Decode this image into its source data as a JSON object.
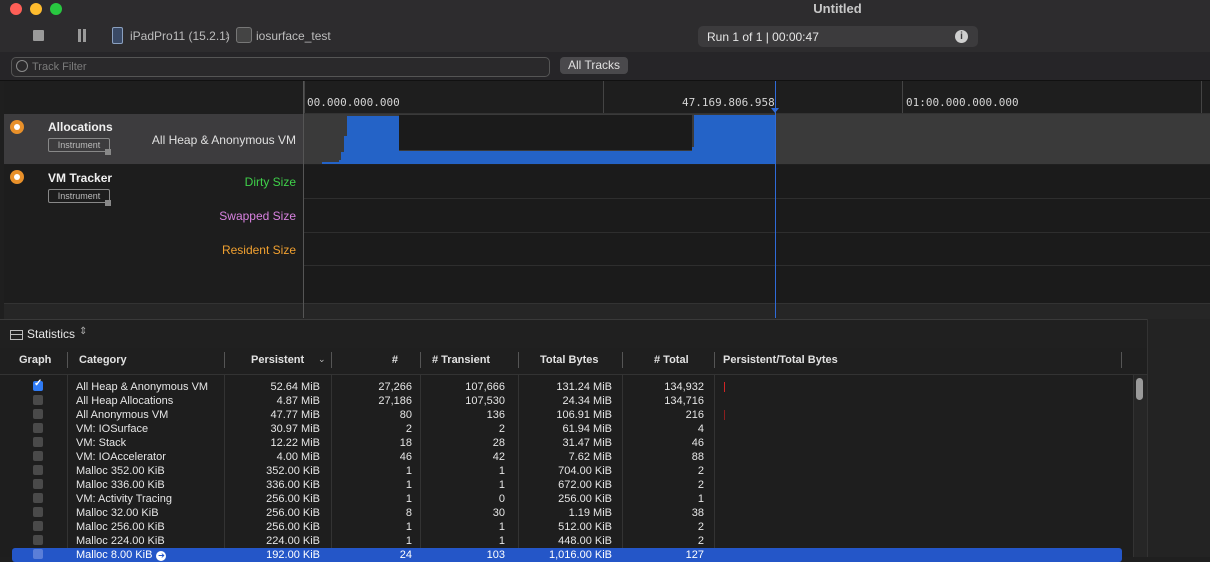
{
  "window": {
    "title": "Untitled"
  },
  "toolbar": {
    "device": "iPadPro11 (15.2.1)",
    "target": "iosurface_test",
    "run_status": "Run 1 of 1  |  00:00:47"
  },
  "filter": {
    "placeholder": "Track Filter",
    "tracks_button": "All Tracks"
  },
  "ruler": {
    "ticks": [
      "00.000.000.000",
      "47.169.806.958",
      "01:00.000.000.000"
    ]
  },
  "tracks": [
    {
      "name": "Instrument_Allocations",
      "title": "Allocations",
      "badge": "Instrument",
      "lanes": [
        "All Heap & Anonymous VM"
      ],
      "lane_colors": [
        "#e0e0e0"
      ]
    },
    {
      "name": "Instrument_VM",
      "title": "VM Tracker",
      "badge": "Instrument",
      "lanes": [
        "Dirty Size",
        "Swapped Size",
        "Resident Size"
      ],
      "lane_colors": [
        "#3fd14a",
        "#d882e0",
        "#f0a030"
      ]
    }
  ],
  "stats": {
    "label": "Statistics"
  },
  "table": {
    "columns": [
      "Graph",
      "Category",
      "Persistent",
      "#",
      "# Transient",
      "Total Bytes",
      "# Total",
      "Persistent/Total Bytes"
    ],
    "rows": [
      {
        "checked": true,
        "category": "All Heap & Anonymous VM",
        "persistent": "52.64 MiB",
        "count": "27,266",
        "transient": "107,666",
        "total_bytes": "131.24 MiB",
        "total": "134,932"
      },
      {
        "checked": false,
        "category": "All Heap Allocations",
        "persistent": "4.87 MiB",
        "count": "27,186",
        "transient": "107,530",
        "total_bytes": "24.34 MiB",
        "total": "134,716"
      },
      {
        "checked": false,
        "category": "All Anonymous VM",
        "persistent": "47.77 MiB",
        "count": "80",
        "transient": "136",
        "total_bytes": "106.91 MiB",
        "total": "216"
      },
      {
        "checked": false,
        "category": "VM: IOSurface",
        "persistent": "30.97 MiB",
        "count": "2",
        "transient": "2",
        "total_bytes": "61.94 MiB",
        "total": "4"
      },
      {
        "checked": false,
        "category": "VM: Stack",
        "persistent": "12.22 MiB",
        "count": "18",
        "transient": "28",
        "total_bytes": "31.47 MiB",
        "total": "46"
      },
      {
        "checked": false,
        "category": "VM: IOAccelerator",
        "persistent": "4.00 MiB",
        "count": "46",
        "transient": "42",
        "total_bytes": "7.62 MiB",
        "total": "88"
      },
      {
        "checked": false,
        "category": "Malloc 352.00 KiB",
        "persistent": "352.00 KiB",
        "count": "1",
        "transient": "1",
        "total_bytes": "704.00 KiB",
        "total": "2"
      },
      {
        "checked": false,
        "category": "Malloc 336.00 KiB",
        "persistent": "336.00 KiB",
        "count": "1",
        "transient": "1",
        "total_bytes": "672.00 KiB",
        "total": "2"
      },
      {
        "checked": false,
        "category": "VM: Activity Tracing",
        "persistent": "256.00 KiB",
        "count": "1",
        "transient": "0",
        "total_bytes": "256.00 KiB",
        "total": "1"
      },
      {
        "checked": false,
        "category": "Malloc 32.00 KiB",
        "persistent": "256.00 KiB",
        "count": "8",
        "transient": "30",
        "total_bytes": "1.19 MiB",
        "total": "38"
      },
      {
        "checked": false,
        "category": "Malloc 256.00 KiB",
        "persistent": "256.00 KiB",
        "count": "1",
        "transient": "1",
        "total_bytes": "512.00 KiB",
        "total": "2"
      },
      {
        "checked": false,
        "category": "Malloc 224.00 KiB",
        "persistent": "224.00 KiB",
        "count": "1",
        "transient": "1",
        "total_bytes": "448.00 KiB",
        "total": "2"
      },
      {
        "checked": false,
        "category": "Malloc 8.00 KiB",
        "persistent": "192.00 KiB",
        "count": "24",
        "transient": "103",
        "total_bytes": "1,016.00 KiB",
        "total": "127"
      }
    ]
  }
}
